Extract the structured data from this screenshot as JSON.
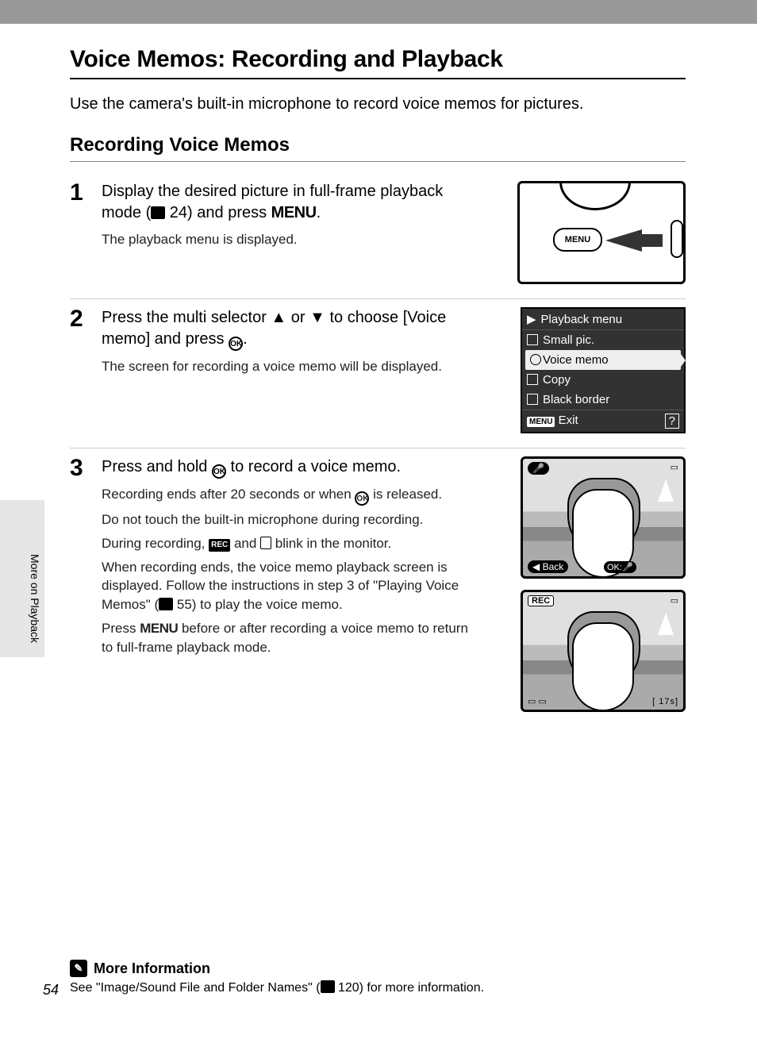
{
  "page_number": "54",
  "side_tab": "More on Playback",
  "title": "Voice Memos: Recording and Playback",
  "intro": "Use the camera's built-in microphone to record voice memos for pictures.",
  "section_heading": "Recording Voice Memos",
  "steps": {
    "s1": {
      "num": "1",
      "lead_a": "Display the desired picture in full-frame playback mode (",
      "lead_ref": " 24) and press ",
      "lead_menu": "MENU",
      "lead_end": ".",
      "p1": "The playback menu is displayed.",
      "diagram_menu": "MENU"
    },
    "s2": {
      "num": "2",
      "lead_a": "Press the multi selector ▲ or ▼ to choose [Voice memo] and press ",
      "lead_end": ".",
      "p1": "The screen for recording a voice memo will be displayed.",
      "menu": {
        "title": "Playback menu",
        "items": [
          "Small pic.",
          "Voice memo",
          "Copy",
          "Black border"
        ],
        "footer_menu": "MENU",
        "footer_exit": "Exit",
        "footer_help": "?"
      }
    },
    "s3": {
      "num": "3",
      "lead_a": "Press and hold ",
      "lead_b": " to record a voice memo.",
      "p1a": "Recording ends after 20 seconds or when ",
      "p1b": " is released.",
      "p2": "Do not touch the built-in microphone during recording.",
      "p3a": "During recording, ",
      "p3_rec": "REC",
      "p3b": " and ",
      "p3c": " blink in the monitor.",
      "p4a": "When recording ends, the voice memo playback screen is displayed. Follow the instructions in step 3 of \"Playing Voice Memos\" (",
      "p4_ref": " 55) to play the voice memo.",
      "p5a": "Press ",
      "p5_menu": "MENU",
      "p5b": " before or after recording a voice memo to return to full-frame playback mode.",
      "shot1": {
        "back": "Back",
        "ok": "OK"
      },
      "shot2": {
        "rec": "REC",
        "time": "[  17s]"
      }
    }
  },
  "more_info": {
    "heading": "More Information",
    "text_a": "See \"Image/Sound File and Folder Names\" (",
    "text_b": " 120) for more information."
  }
}
